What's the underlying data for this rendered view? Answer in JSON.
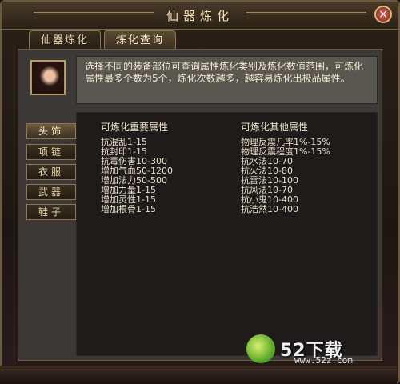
{
  "window": {
    "title": "仙器炼化",
    "close_glyph": "×"
  },
  "tabs": [
    {
      "label": "仙器炼化",
      "active": false
    },
    {
      "label": "炼化查询",
      "active": true
    }
  ],
  "description": "选择不同的装备部位可查询属性炼化类别及炼化数值范围，可炼化属性最多个数为5个，炼化次数越多，越容易炼化出极品属性。",
  "categories": [
    {
      "label": "头饰",
      "active": true
    },
    {
      "label": "项链",
      "active": false
    },
    {
      "label": "衣服",
      "active": false
    },
    {
      "label": "武器",
      "active": false
    },
    {
      "label": "鞋子",
      "active": false
    }
  ],
  "main_attrs": {
    "header": "可炼化重要属性",
    "items": [
      "抗混乱1-15",
      "抗封印1-15",
      "抗毒伤害10-300",
      "增加气血50-1200",
      "增加法力50-500",
      "增加力量1-15",
      "增加灵性1-15",
      "增加根骨1-15"
    ]
  },
  "other_attrs": {
    "header": "可炼化其他属性",
    "items": [
      "物理反震几率1%-15%",
      "物理反震程度1%-15%",
      "抗水法10-70",
      "抗火法10-80",
      "抗雷法10-100",
      "抗风法10-70",
      "抗小鬼10-400",
      "抗浩然10-400"
    ]
  },
  "watermark": {
    "text": "52下载",
    "url": "www.52z.com"
  }
}
